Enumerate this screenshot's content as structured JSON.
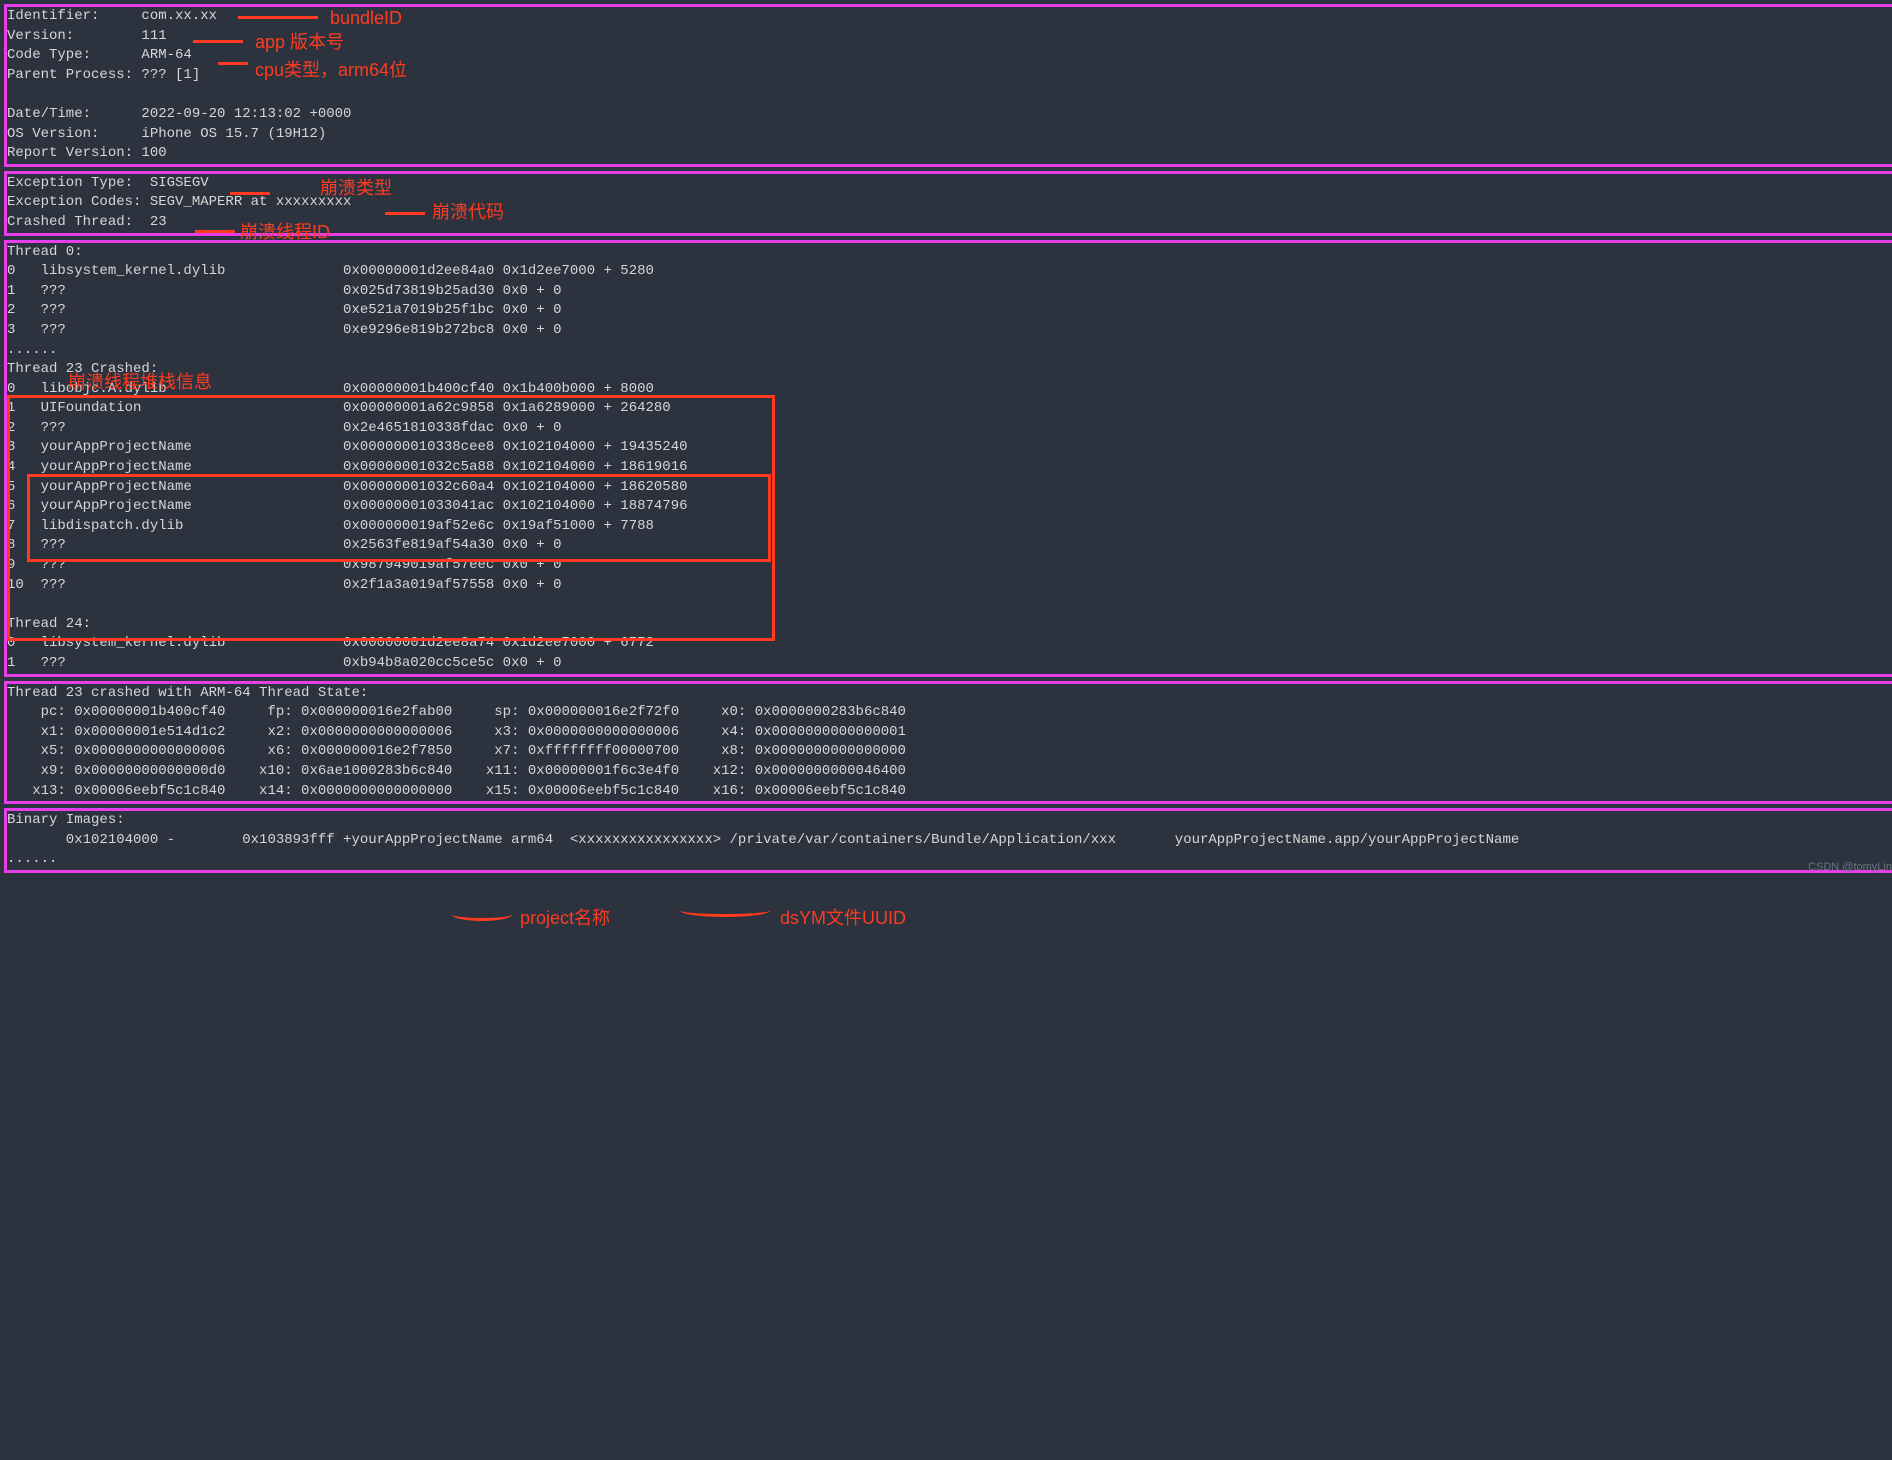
{
  "header": {
    "identifier": "Identifier:     com.xx.xx",
    "version": "Version:        111",
    "codetype": "Code Type:      ARM-64",
    "parent": "Parent Process: ??? [1]",
    "blank": "",
    "datetime": "Date/Time:      2022-09-20 12:13:02 +0000",
    "osver": "OS Version:     iPhone OS 15.7 (19H12)",
    "reportver": "Report Version: 100"
  },
  "exception": {
    "type": "Exception Type:  SIGSEGV",
    "codes": "Exception Codes: SEGV_MAPERR at xxxxxxxxx",
    "thread": "Crashed Thread:  23"
  },
  "threads": {
    "t0": "Thread 0:",
    "t0_0": "0   libsystem_kernel.dylib              0x00000001d2ee84a0 0x1d2ee7000 + 5280",
    "t0_1": "1   ???                                 0x025d73819b25ad30 0x0 + 0",
    "t0_2": "2   ???                                 0xe521a7019b25f1bc 0x0 + 0",
    "t0_3": "3   ???                                 0xe9296e819b272bc8 0x0 + 0",
    "dots1": "......",
    "t23": "Thread 23 Crashed:",
    "t23_0": "0   libobjc.A.dylib                     0x00000001b400cf40 0x1b400b000 + 8000",
    "t23_1": "1   UIFoundation                        0x00000001a62c9858 0x1a6289000 + 264280",
    "t23_2": "2   ???                                 0x2e4651810338fdac 0x0 + 0",
    "t23_3": "3   yourAppProjectName                  0x000000010338cee8 0x102104000 + 19435240",
    "t23_4": "4   yourAppProjectName                  0x00000001032c5a88 0x102104000 + 18619016",
    "t23_5": "5   yourAppProjectName                  0x00000001032c60a4 0x102104000 + 18620580",
    "t23_6": "6   yourAppProjectName                  0x00000001033041ac 0x102104000 + 18874796",
    "t23_7": "7   libdispatch.dylib                   0x000000019af52e6c 0x19af51000 + 7788",
    "t23_8": "8   ???                                 0x2563fe819af54a30 0x0 + 0",
    "t23_9": "9   ???                                 0x987949019af57eec 0x0 + 0",
    "t23_10": "10  ???                                 0x2f1a3a019af57558 0x0 + 0",
    "blank": "",
    "t24": "Thread 24:",
    "t24_0": "0   libsystem_kernel.dylib              0x00000001d2ee8a74 0x1d2ee7000 + 6772",
    "t24_1": "1   ???                                 0xb94b8a020cc5ce5c 0x0 + 0"
  },
  "state": {
    "title": "Thread 23 crashed with ARM-64 Thread State:",
    "r1": "    pc: 0x00000001b400cf40     fp: 0x000000016e2fab00     sp: 0x000000016e2f72f0     x0: 0x0000000283b6c840",
    "r2": "    x1: 0x00000001e514d1c2     x2: 0x0000000000000006     x3: 0x0000000000000006     x4: 0x0000000000000001",
    "r3": "    x5: 0x0000000000000006     x6: 0x000000016e2f7850     x7: 0xffffffff00000700     x8: 0x0000000000000000",
    "r4": "    x9: 0x00000000000000d0    x10: 0x6ae1000283b6c840    x11: 0x00000001f6c3e4f0    x12: 0x0000000000046400",
    "r5": "   x13: 0x00006eebf5c1c840    x14: 0x0000000000000000    x15: 0x00006eebf5c1c840    x16: 0x00006eebf5c1c840"
  },
  "binary": {
    "title": "Binary Images:",
    "line": "       0x102104000 -        0x103893fff +yourAppProjectName arm64  <xxxxxxxxxxxxxxxx> /private/var/containers/Bundle/Application/xxx       yourAppProjectName.app/yourAppProjectName",
    "dots": "......"
  },
  "annotations": {
    "bundleID": "bundleID",
    "appVersion": "app 版本号",
    "cpuType": "cpu类型，arm64位",
    "crashType": "崩溃类型",
    "crashCode": "崩溃代码",
    "crashThreadID": "崩溃线程ID",
    "crashStack": "崩溃线程堆栈信息",
    "projectName": "project名称",
    "dsymUUID": "dsYM文件UUID"
  },
  "watermark": "CSDN @tomyLin"
}
